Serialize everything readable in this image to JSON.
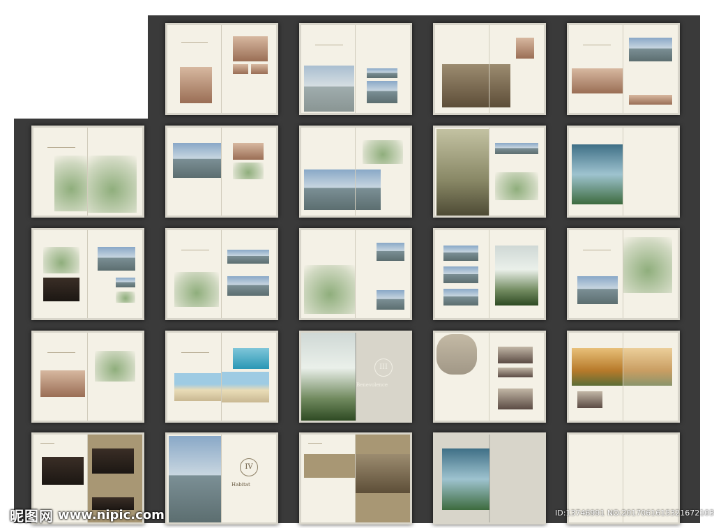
{
  "watermark": {
    "site_cn": "昵图网",
    "site_url": "www.nipic.com",
    "image_id": "ID:13746991 NO:20170616153216721037"
  },
  "spreads": [
    {
      "id": "s01"
    },
    {
      "id": "s02"
    },
    {
      "id": "s03"
    },
    {
      "id": "s04"
    },
    {
      "id": "s05"
    },
    {
      "id": "s06"
    },
    {
      "id": "s07"
    },
    {
      "id": "s08"
    },
    {
      "id": "s09"
    },
    {
      "id": "s10"
    },
    {
      "id": "s11"
    },
    {
      "id": "s12"
    },
    {
      "id": "s13"
    },
    {
      "id": "s14"
    },
    {
      "id": "s15"
    },
    {
      "id": "s16"
    },
    {
      "id": "s17"
    },
    {
      "id": "s18"
    },
    {
      "id": "s19"
    },
    {
      "id": "s20"
    },
    {
      "id": "s21"
    },
    {
      "id": "s22"
    },
    {
      "id": "s23"
    },
    {
      "id": "s24"
    }
  ],
  "chapter_marks": {
    "chapter_3": "III",
    "chapter_4": "IV",
    "chapter_3_title": "Benevolence",
    "chapter_4_title": "Habitat"
  }
}
